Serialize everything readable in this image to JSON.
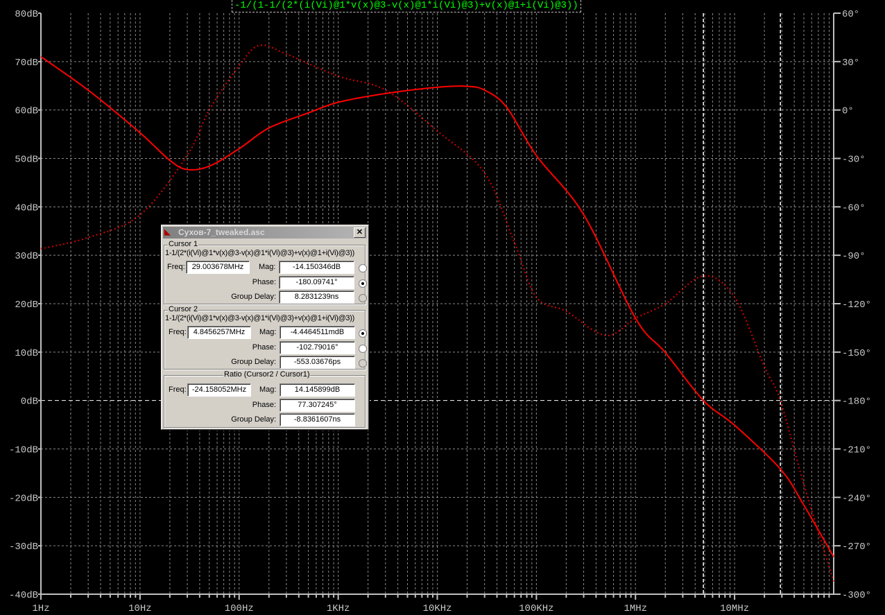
{
  "chart_data": {
    "type": "line",
    "title": "-1/(1-1/(2*(i(Vi)@1*v(x)@3-v(x)@1*i(Vi)@3)+v(x)@1+i(Vi)@3))",
    "x_scale": "log",
    "xlim": [
      1,
      100000000
    ],
    "ylim_left": [
      -40,
      80
    ],
    "ylim_right": [
      -300,
      60
    ],
    "x_ticks": [
      {
        "v": 1,
        "label": "1Hz"
      },
      {
        "v": 10,
        "label": "10Hz"
      },
      {
        "v": 100,
        "label": "100Hz"
      },
      {
        "v": 1000,
        "label": "1KHz"
      },
      {
        "v": 10000,
        "label": "10KHz"
      },
      {
        "v": 100000,
        "label": "100KHz"
      },
      {
        "v": 1000000,
        "label": "1MHz"
      },
      {
        "v": 10000000,
        "label": "10MHz"
      }
    ],
    "y_left_ticks": [
      {
        "v": 80,
        "label": "80dB"
      },
      {
        "v": 70,
        "label": "70dB"
      },
      {
        "v": 60,
        "label": "60dB"
      },
      {
        "v": 50,
        "label": "50dB"
      },
      {
        "v": 40,
        "label": "40dB"
      },
      {
        "v": 30,
        "label": "30dB"
      },
      {
        "v": 20,
        "label": "20dB"
      },
      {
        "v": 10,
        "label": "10dB"
      },
      {
        "v": 0,
        "label": "0dB"
      },
      {
        "v": -10,
        "label": "-10dB"
      },
      {
        "v": -20,
        "label": "-20dB"
      },
      {
        "v": -30,
        "label": "-30dB"
      },
      {
        "v": -40,
        "label": "-40dB"
      }
    ],
    "y_right_ticks": [
      {
        "v": 60,
        "label": "60°"
      },
      {
        "v": 30,
        "label": "30°"
      },
      {
        "v": 0,
        "label": "0°"
      },
      {
        "v": -30,
        "label": "-30°"
      },
      {
        "v": -60,
        "label": "-60°"
      },
      {
        "v": -90,
        "label": "-90°"
      },
      {
        "v": -120,
        "label": "-120°"
      },
      {
        "v": -150,
        "label": "-150°"
      },
      {
        "v": -180,
        "label": "-180°"
      },
      {
        "v": -210,
        "label": "-210°"
      },
      {
        "v": -240,
        "label": "-240°"
      },
      {
        "v": -270,
        "label": "-270°"
      },
      {
        "v": -300,
        "label": "-300°"
      }
    ],
    "grid": true,
    "series": [
      {
        "axis": "left",
        "style": "solid",
        "color": "#ff0000",
        "x": [
          1,
          3,
          10,
          20,
          30,
          50,
          100,
          200,
          500,
          1000,
          3000,
          10000,
          20000,
          30000,
          50000,
          100000,
          300000,
          1000000,
          2000000,
          4845626,
          10000000,
          29003678,
          50000000,
          100000000
        ],
        "y": [
          71,
          64.1,
          55.3,
          49.6,
          47.7,
          48.4,
          52,
          56.3,
          59.4,
          61.6,
          63.4,
          64.7,
          64.9,
          64.1,
          60.6,
          50.6,
          38.4,
          17,
          9.9,
          0,
          -5.1,
          -14.15,
          -21.6,
          -32.3
        ]
      },
      {
        "axis": "right",
        "style": "dotted",
        "color": "#ff0000",
        "x": [
          1,
          3,
          10,
          30,
          50,
          100,
          160,
          300,
          1000,
          3000,
          10000,
          30000,
          60000,
          100000,
          200000,
          500000,
          1000000,
          2000000,
          4845626,
          10000000,
          20000000,
          29003678,
          50000000,
          100000000
        ],
        "y": [
          -86,
          -79,
          -65,
          -28,
          0,
          27.4,
          40,
          34.7,
          21,
          12.4,
          -13,
          -39,
          -82,
          -116,
          -124.7,
          -139.7,
          -129,
          -120,
          -102.8,
          -116,
          -159,
          -180.1,
          -232,
          -292
        ]
      }
    ],
    "cursors": [
      4845626,
      29003678
    ]
  },
  "dialog": {
    "title": "Сухов-7_tweaked.asc",
    "close": "✕",
    "cursor1": {
      "label": "Cursor 1",
      "expr": "1-1/(2*(i(Vi)@1*v(x)@3-v(x)@1*i(Vi)@3)+v(x)@1+i(Vi)@3))",
      "freq_label": "Freq:",
      "freq": "29.003678MHz",
      "mag_label": "Mag:",
      "mag": "-14.150346dB",
      "phase_label": "Phase:",
      "phase": "-180.09741°",
      "gd_label": "Group Delay:",
      "gd": "8.2831239ns",
      "selected": "phase"
    },
    "cursor2": {
      "label": "Cursor 2",
      "expr": "1-1/(2*(i(Vi)@1*v(x)@3-v(x)@1*i(Vi)@3)+v(x)@1+i(Vi)@3))",
      "freq_label": "Freq:",
      "freq": "4.8456257MHz",
      "mag_label": "Mag:",
      "mag": "-4.4464511mdB",
      "phase_label": "Phase:",
      "phase": "-102.79016°",
      "gd_label": "Group Delay:",
      "gd": "-553.03676ps",
      "selected": "mag"
    },
    "ratio": {
      "label": "Ratio (Cursor2 / Cursor1)",
      "freq_label": "Freq:",
      "freq": "-24.158052MHz",
      "mag_label": "Mag:",
      "mag": "14.145899dB",
      "phase_label": "Phase:",
      "phase": "77.307245°",
      "gd_label": "Group Delay:",
      "gd": "-8.8361607ns"
    }
  }
}
